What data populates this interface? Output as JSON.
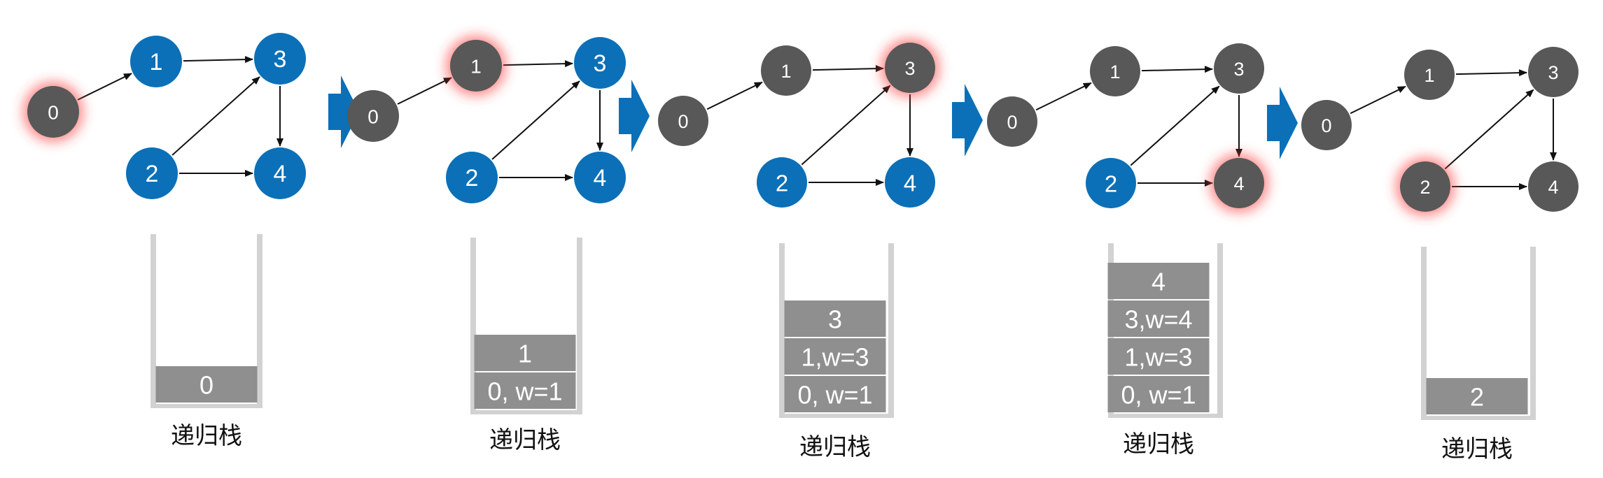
{
  "colors": {
    "active_node": "#0b70b7",
    "visited_node": "#585858",
    "stack_cell": "#8f8f8f",
    "stack_wall": "#d2d2d2",
    "arrow": "#111111",
    "transition_arrow": "#0b70b7",
    "glow": "#ff3b3b"
  },
  "frames": [
    {
      "nodes": [
        {
          "id": "0",
          "label": "0",
          "state": "visited",
          "glow": true
        },
        {
          "id": "1",
          "label": "1",
          "state": "active",
          "glow": false
        },
        {
          "id": "2",
          "label": "2",
          "state": "active",
          "glow": false
        },
        {
          "id": "3",
          "label": "3",
          "state": "active",
          "glow": false
        },
        {
          "id": "4",
          "label": "4",
          "state": "active",
          "glow": false
        }
      ],
      "stack": [
        "0"
      ],
      "label": "递归栈"
    },
    {
      "nodes": [
        {
          "id": "0",
          "label": "0",
          "state": "visited",
          "glow": false
        },
        {
          "id": "1",
          "label": "1",
          "state": "visited",
          "glow": true
        },
        {
          "id": "2",
          "label": "2",
          "state": "active",
          "glow": false
        },
        {
          "id": "3",
          "label": "3",
          "state": "active",
          "glow": false
        },
        {
          "id": "4",
          "label": "4",
          "state": "active",
          "glow": false
        }
      ],
      "stack": [
        "1",
        "0, w=1"
      ],
      "label": "递归栈"
    },
    {
      "nodes": [
        {
          "id": "0",
          "label": "0",
          "state": "visited",
          "glow": false
        },
        {
          "id": "1",
          "label": "1",
          "state": "visited",
          "glow": false
        },
        {
          "id": "2",
          "label": "2",
          "state": "active",
          "glow": false
        },
        {
          "id": "3",
          "label": "3",
          "state": "visited",
          "glow": true
        },
        {
          "id": "4",
          "label": "4",
          "state": "active",
          "glow": false
        }
      ],
      "stack": [
        "3",
        "1,w=3",
        "0, w=1"
      ],
      "label": "递归栈"
    },
    {
      "nodes": [
        {
          "id": "0",
          "label": "0",
          "state": "visited",
          "glow": false
        },
        {
          "id": "1",
          "label": "1",
          "state": "visited",
          "glow": false
        },
        {
          "id": "2",
          "label": "2",
          "state": "active",
          "glow": false
        },
        {
          "id": "3",
          "label": "3",
          "state": "visited",
          "glow": false
        },
        {
          "id": "4",
          "label": "4",
          "state": "visited",
          "glow": true
        }
      ],
      "stack": [
        "4",
        "3,w=4",
        "1,w=3",
        "0, w=1"
      ],
      "label": "递归栈"
    },
    {
      "nodes": [
        {
          "id": "0",
          "label": "0",
          "state": "visited",
          "glow": false
        },
        {
          "id": "1",
          "label": "1",
          "state": "visited",
          "glow": false
        },
        {
          "id": "2",
          "label": "2",
          "state": "visited",
          "glow": true
        },
        {
          "id": "3",
          "label": "3",
          "state": "visited",
          "glow": false
        },
        {
          "id": "4",
          "label": "4",
          "state": "visited",
          "glow": false
        }
      ],
      "stack": [
        "2"
      ],
      "label": "递归栈"
    }
  ],
  "edges": [
    {
      "from": "0",
      "to": "1"
    },
    {
      "from": "1",
      "to": "3"
    },
    {
      "from": "2",
      "to": "3"
    },
    {
      "from": "2",
      "to": "4"
    },
    {
      "from": "3",
      "to": "4"
    }
  ]
}
